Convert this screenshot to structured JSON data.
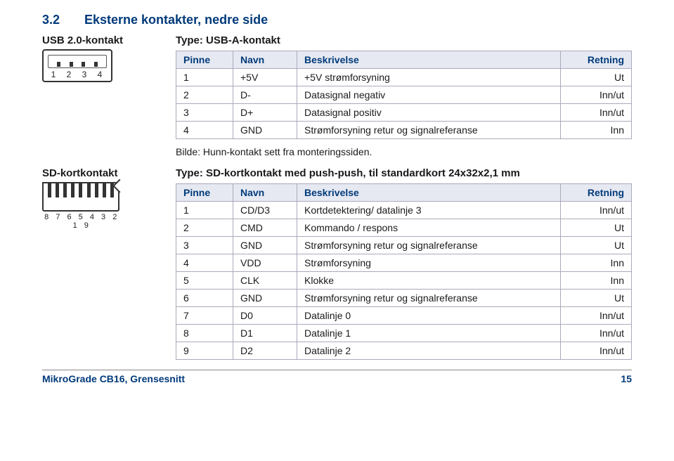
{
  "heading": {
    "number": "3.2",
    "title": "Eksterne kontakter, nedre side"
  },
  "usb": {
    "label": "USB 2.0-kontakt",
    "type_line": "Type: USB-A-kontakt",
    "pin_labels": "1 2 3 4",
    "headers": [
      "Pinne",
      "Navn",
      "Beskrivelse",
      "Retning"
    ],
    "rows": [
      {
        "pinne": "1",
        "navn": "+5V",
        "besk": "+5V strømforsyning",
        "ret": "Ut"
      },
      {
        "pinne": "2",
        "navn": "D-",
        "besk": "Datasignal negativ",
        "ret": "Inn/ut"
      },
      {
        "pinne": "3",
        "navn": "D+",
        "besk": "Datasignal positiv",
        "ret": "Inn/ut"
      },
      {
        "pinne": "4",
        "navn": "GND",
        "besk": "Strømforsyning retur og signalreferanse",
        "ret": "Inn"
      }
    ],
    "caption": "Bilde: Hunn-kontakt sett fra monteringssiden."
  },
  "sd": {
    "label": "SD-kortkontakt",
    "type_line": "Type: SD-kortkontakt med push-push, til standardkort 24x32x2,1 mm",
    "pin_labels": "8 7 6 5 4 3 2 1 9",
    "headers": [
      "Pinne",
      "Navn",
      "Beskrivelse",
      "Retning"
    ],
    "rows": [
      {
        "pinne": "1",
        "navn": "CD/D3",
        "besk": "Kortdetektering/ datalinje 3",
        "ret": "Inn/ut"
      },
      {
        "pinne": "2",
        "navn": "CMD",
        "besk": "Kommando / respons",
        "ret": "Ut"
      },
      {
        "pinne": "3",
        "navn": "GND",
        "besk": "Strømforsyning retur og signalreferanse",
        "ret": "Ut"
      },
      {
        "pinne": "4",
        "navn": "VDD",
        "besk": "Strømforsyning",
        "ret": "Inn"
      },
      {
        "pinne": "5",
        "navn": "CLK",
        "besk": "Klokke",
        "ret": "Inn"
      },
      {
        "pinne": "6",
        "navn": "GND",
        "besk": "Strømforsyning retur og signalreferanse",
        "ret": "Ut"
      },
      {
        "pinne": "7",
        "navn": "D0",
        "besk": "Datalinje 0",
        "ret": "Inn/ut"
      },
      {
        "pinne": "8",
        "navn": "D1",
        "besk": "Datalinje 1",
        "ret": "Inn/ut"
      },
      {
        "pinne": "9",
        "navn": "D2",
        "besk": "Datalinje 2",
        "ret": "Inn/ut"
      }
    ]
  },
  "footer": {
    "left": "MikroGrade CB16, Grensesnitt",
    "right": "15"
  }
}
